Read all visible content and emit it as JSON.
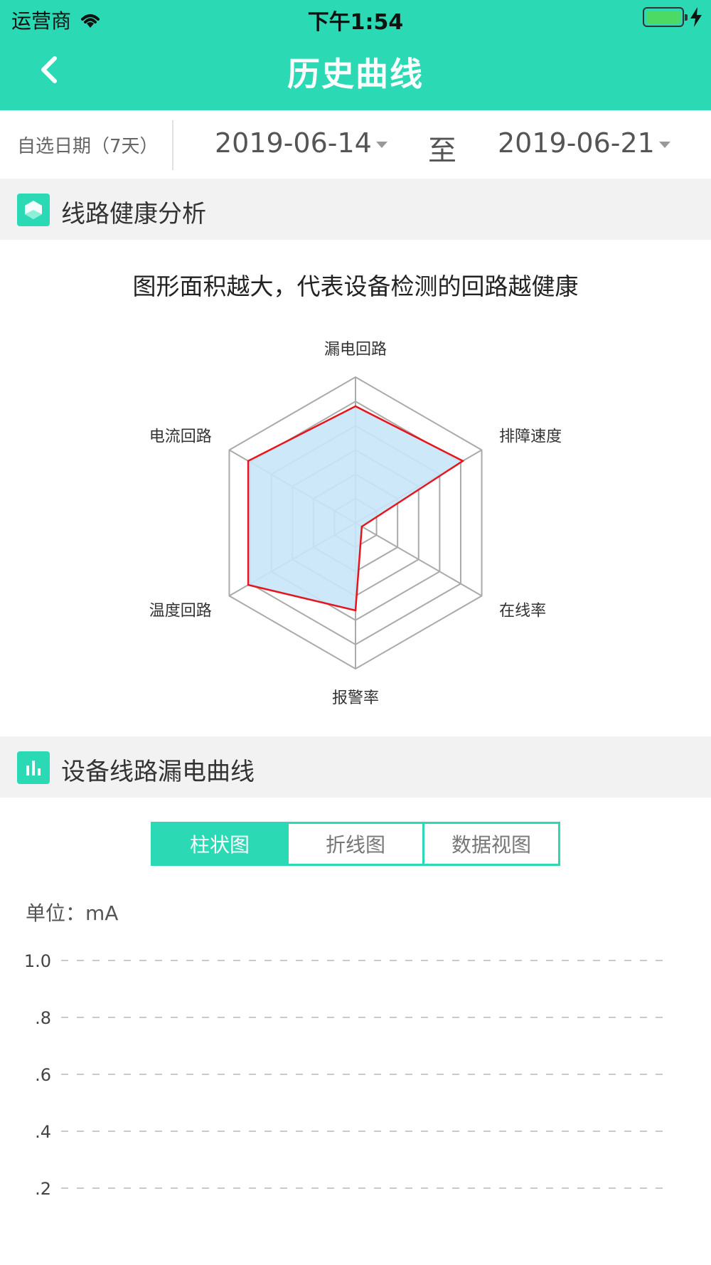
{
  "status_bar": {
    "carrier": "运营商",
    "time": "下午1:54"
  },
  "nav": {
    "title": "历史曲线"
  },
  "date_filter": {
    "label": "自选日期（7天）",
    "start_date": "2019-06-14",
    "separator": "至",
    "end_date": "2019-06-21"
  },
  "health_section": {
    "title": "线路健康分析",
    "caption": "图形面积越大，代表设备检测的回路越健康"
  },
  "leakage_section": {
    "title": "设备线路漏电曲线"
  },
  "view_tabs": [
    {
      "label": "柱状图",
      "active": true
    },
    {
      "label": "折线图",
      "active": false
    },
    {
      "label": "数据视图",
      "active": false
    }
  ],
  "colors": {
    "accent": "#2bdab5",
    "radar_line": "#e8141c",
    "radar_fill": "#c8e6f8"
  },
  "chart_data": [
    {
      "type": "radar",
      "axes": [
        "漏电回路",
        "排障速度",
        "在线率",
        "报警率",
        "温度回路",
        "电流回路"
      ],
      "values": [
        0.8,
        0.85,
        0.05,
        0.6,
        0.85,
        0.85
      ],
      "range": [
        0,
        1
      ]
    },
    {
      "type": "bar",
      "unit_label": "单位：",
      "unit": "mA",
      "ylim": [
        0,
        1.0
      ],
      "yticks": [
        "1.0",
        ".8",
        ".6",
        ".4",
        ".2"
      ],
      "series": []
    }
  ]
}
